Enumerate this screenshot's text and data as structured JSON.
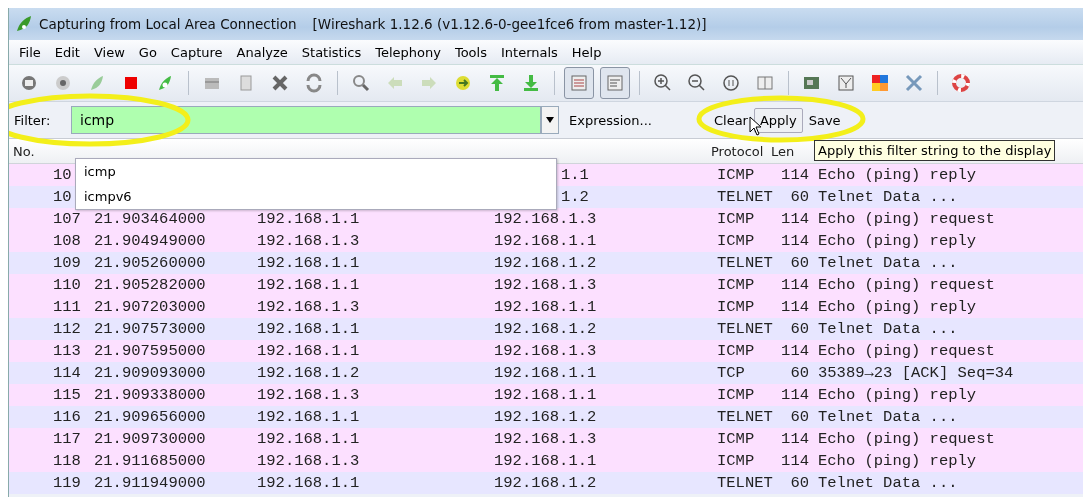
{
  "window": {
    "title": "Capturing from Local Area Connection",
    "subtitle": "[Wireshark 1.12.6  (v1.12.6-0-gee1fce6 from master-1.12)]"
  },
  "menu": [
    {
      "label": "File"
    },
    {
      "label": "Edit"
    },
    {
      "label": "View"
    },
    {
      "label": "Go"
    },
    {
      "label": "Capture"
    },
    {
      "label": "Analyze"
    },
    {
      "label": "Statistics"
    },
    {
      "label": "Telephony"
    },
    {
      "label": "Tools"
    },
    {
      "label": "Internals"
    },
    {
      "label": "Help"
    }
  ],
  "pane_toggles": [
    {
      "on": true
    },
    {
      "on": true
    }
  ],
  "filter_bar": {
    "label": "Filter:",
    "value": "icmp",
    "expression_link": "Expression...",
    "buttons": [
      {
        "label": "Clear",
        "hovered": false
      },
      {
        "label": "Apply",
        "hovered": true
      },
      {
        "label": "Save",
        "hovered": false
      }
    ]
  },
  "autocomplete": [
    "icmp",
    "icmpv6"
  ],
  "tooltip": "Apply this filter string to the display",
  "packet_list": {
    "columns": [
      "No.",
      "Protocol",
      "Len"
    ],
    "rows": [
      {
        "no": "10",
        "destination": "1.1",
        "protocol": "ICMP",
        "length": "114",
        "info": "Echo (ping) reply",
        "color": "#fce0ff"
      },
      {
        "no": "10",
        "destination": "1.2",
        "protocol": "TELNET",
        "length": "60",
        "info": "Telnet Data ...",
        "color": "#e7e6ff"
      },
      {
        "no": "107",
        "time": "21.903464000",
        "source": "192.168.1.1",
        "destination": "192.168.1.3",
        "protocol": "ICMP",
        "length": "114",
        "info": "Echo (ping) request",
        "color": "#fce0ff"
      },
      {
        "no": "108",
        "time": "21.904949000",
        "source": "192.168.1.3",
        "destination": "192.168.1.1",
        "protocol": "ICMP",
        "length": "114",
        "info": "Echo (ping) reply",
        "color": "#fce0ff"
      },
      {
        "no": "109",
        "time": "21.905260000",
        "source": "192.168.1.1",
        "destination": "192.168.1.2",
        "protocol": "TELNET",
        "length": "60",
        "info": "Telnet Data ...",
        "color": "#e7e6ff"
      },
      {
        "no": "110",
        "time": "21.905282000",
        "source": "192.168.1.1",
        "destination": "192.168.1.3",
        "protocol": "ICMP",
        "length": "114",
        "info": "Echo (ping) request",
        "color": "#fce0ff"
      },
      {
        "no": "111",
        "time": "21.907203000",
        "source": "192.168.1.3",
        "destination": "192.168.1.1",
        "protocol": "ICMP",
        "length": "114",
        "info": "Echo (ping) reply",
        "color": "#fce0ff"
      },
      {
        "no": "112",
        "time": "21.907573000",
        "source": "192.168.1.1",
        "destination": "192.168.1.2",
        "protocol": "TELNET",
        "length": "60",
        "info": "Telnet Data ...",
        "color": "#e7e6ff"
      },
      {
        "no": "113",
        "time": "21.907595000",
        "source": "192.168.1.1",
        "destination": "192.168.1.3",
        "protocol": "ICMP",
        "length": "114",
        "info": "Echo (ping) request",
        "color": "#fce0ff"
      },
      {
        "no": "114",
        "time": "21.909093000",
        "source": "192.168.1.2",
        "destination": "192.168.1.1",
        "protocol": "TCP",
        "length": "60",
        "info": "35389→23 [ACK] Seq=34",
        "color": "#e7e6ff"
      },
      {
        "no": "115",
        "time": "21.909338000",
        "source": "192.168.1.3",
        "destination": "192.168.1.1",
        "protocol": "ICMP",
        "length": "114",
        "info": "Echo (ping) reply",
        "color": "#fce0ff"
      },
      {
        "no": "116",
        "time": "21.909656000",
        "source": "192.168.1.1",
        "destination": "192.168.1.2",
        "protocol": "TELNET",
        "length": "60",
        "info": "Telnet Data ...",
        "color": "#e7e6ff"
      },
      {
        "no": "117",
        "time": "21.909730000",
        "source": "192.168.1.1",
        "destination": "192.168.1.3",
        "protocol": "ICMP",
        "length": "114",
        "info": "Echo (ping) request",
        "color": "#fce0ff"
      },
      {
        "no": "118",
        "time": "21.911685000",
        "source": "192.168.1.3",
        "destination": "192.168.1.1",
        "protocol": "ICMP",
        "length": "114",
        "info": "Echo (ping) reply",
        "color": "#fce0ff"
      },
      {
        "no": "119",
        "time": "21.911949000",
        "source": "192.168.1.1",
        "destination": "192.168.1.2",
        "protocol": "TELNET",
        "length": "60",
        "info": "Telnet Data ...",
        "color": "#e7e6ff"
      }
    ]
  }
}
